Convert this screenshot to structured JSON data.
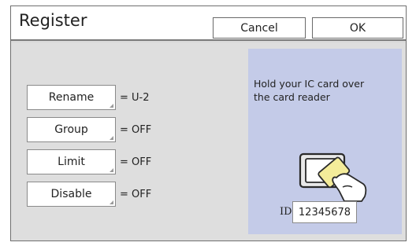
{
  "header": {
    "title": "Register",
    "cancel_label": "Cancel",
    "ok_label": "OK"
  },
  "settings": [
    {
      "label": "Rename",
      "value": "= U-2"
    },
    {
      "label": "Group",
      "value": "= OFF"
    },
    {
      "label": "Limit",
      "value": "= OFF"
    },
    {
      "label": "Disable",
      "value": "= OFF"
    }
  ],
  "panel": {
    "message_line1": "Hold your IC card over",
    "message_line2": "the card reader",
    "icon": "ic-card-reader-icon",
    "id_label": "ID",
    "id_value": "12345678"
  },
  "colors": {
    "panel_bg": "#c4cbe8",
    "card_fill": "#f4ec9a",
    "background": "#dedede"
  }
}
